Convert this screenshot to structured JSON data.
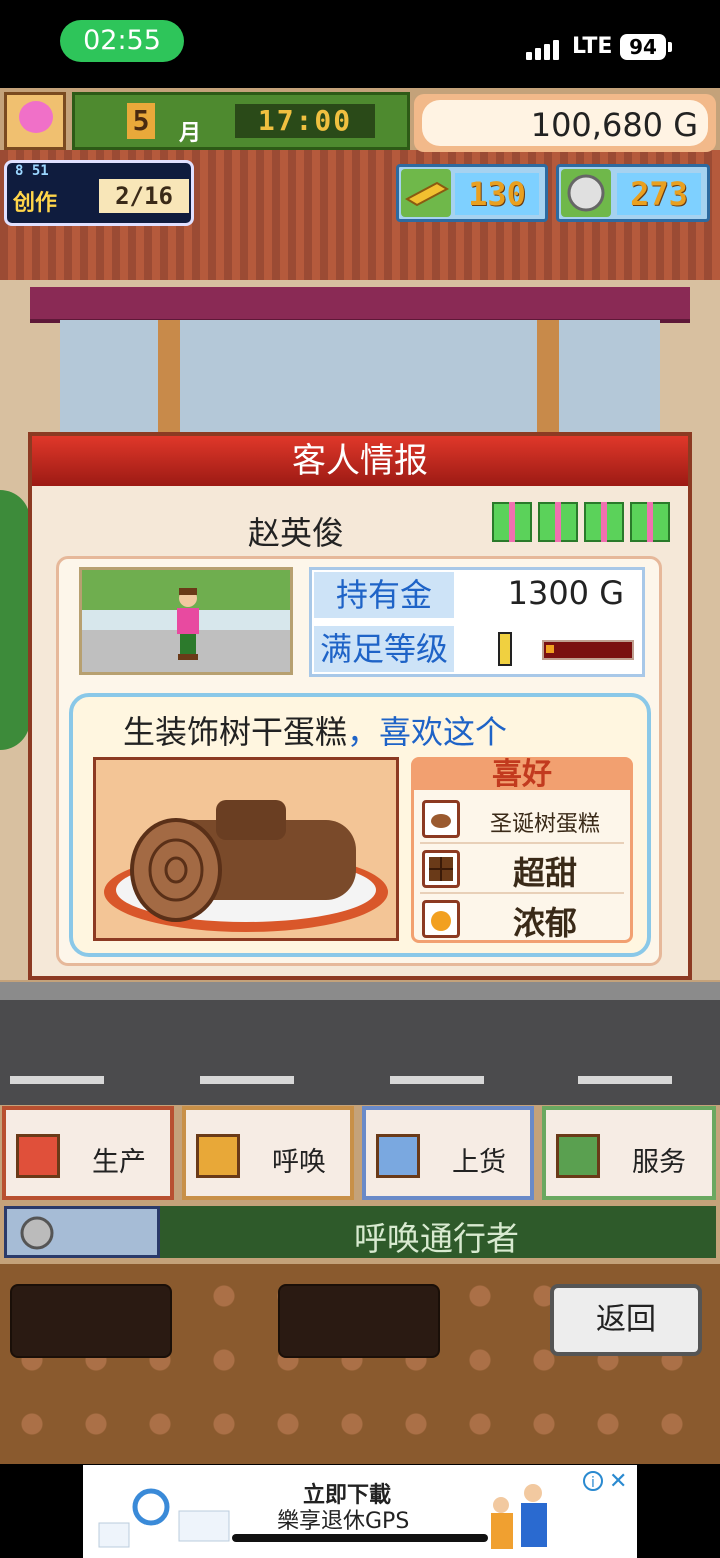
{
  "status_bar": {
    "time": "02:55",
    "network": "LTE",
    "battery": "94"
  },
  "hud": {
    "month_number": "5",
    "month_unit": "月",
    "clock": "17:00",
    "money": "100,680 G",
    "create_label": "创作",
    "create_levels": "8 51",
    "create_count": "2/16",
    "gold_bars": "130",
    "medals": "273"
  },
  "dialog": {
    "title": "客人情报",
    "guest_name": "赵英俊",
    "gold_label": "持有金",
    "gold_value": "1300 G",
    "satisfaction_label": "满足等级",
    "satisfaction_level": 0.1,
    "bubble_item": "生装饰树干蛋糕",
    "bubble_sep": "，",
    "bubble_like": "喜欢这个",
    "pref_title": "喜好",
    "prefs": [
      {
        "icon": "cake-icon",
        "label": "圣诞树蛋糕"
      },
      {
        "icon": "chocolate-icon",
        "label": "超甜"
      },
      {
        "icon": "orange-icon",
        "label": "浓郁"
      }
    ]
  },
  "menu": {
    "produce": "生产",
    "call": "呼唤",
    "stock": "上货",
    "service": "服务"
  },
  "call_bar": {
    "label": "呼唤通行者"
  },
  "back_button": "返回",
  "ad": {
    "line1": "立即下載",
    "line2": "樂享退休GPS"
  },
  "colors": {
    "dialog_header": "#c5261d",
    "highlight_blue": "#1e63c7",
    "menu_green": "#2e5a2a"
  }
}
